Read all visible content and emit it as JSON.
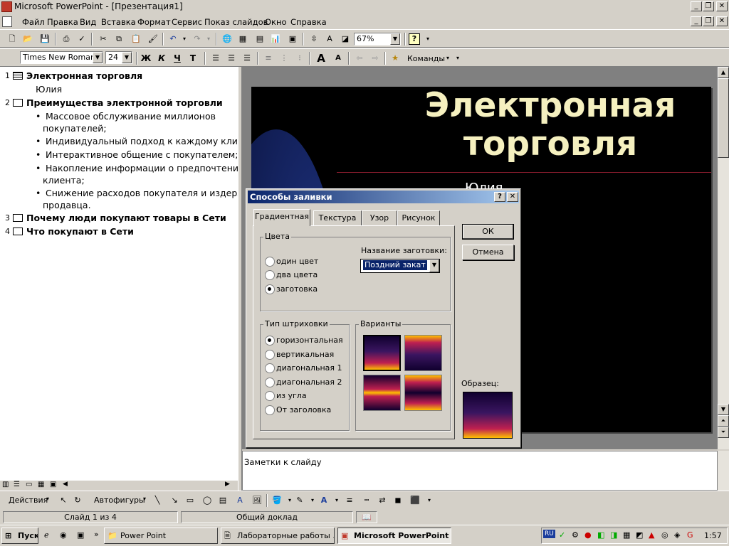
{
  "app": {
    "title": "Microsoft PowerPoint - [Презентация1]"
  },
  "menu": [
    "Файл",
    "Правка",
    "Вид",
    "Вставка",
    "Формат",
    "Сервис",
    "Показ слайдов",
    "Окно",
    "Справка"
  ],
  "toolbar": {
    "zoom": "67%",
    "help": "?",
    "font_name": "Times New Roman",
    "font_size": "24",
    "commands": "Команды"
  },
  "outline": {
    "slides": [
      {
        "num": "1",
        "title": "Электронная торговля",
        "sub": [
          "Юлия"
        ]
      },
      {
        "num": "2",
        "title": "Преимущества электронной торговли",
        "bullets": [
          [
            "Массовое обслуживание миллионов",
            "покупателей;"
          ],
          [
            "Индивидуальный подход к каждому клиенту;"
          ],
          [
            "Интерактивное общение с покупателем;"
          ],
          [
            "Накопление информации о предпочтениях",
            "клиента;"
          ],
          [
            "Снижение расходов покупателя и издержек",
            "продавца."
          ]
        ]
      },
      {
        "num": "3",
        "title": "Почему люди покупают товары в Сети"
      },
      {
        "num": "4",
        "title": "Что покупают в Сети"
      }
    ]
  },
  "slide": {
    "title_line1": "Электронная",
    "title_line2": "торговля",
    "subtitle": "Юлия",
    "title_color": "#f5f0bf"
  },
  "notes": {
    "text": "Заметки к слайду"
  },
  "drawing": {
    "actions": "Действия",
    "autoshapes": "Автофигуры"
  },
  "status": {
    "slide": "Слайд 1 из 4",
    "design": "Общий доклад"
  },
  "taskbar": {
    "start": "Пуск",
    "buttons": [
      "Power Point",
      "Лабораторные работы ...",
      "Microsoft PowerPoint ..."
    ],
    "lang": "RU",
    "clock": "1:57"
  },
  "dialog": {
    "title": "Способы заливки",
    "help": "?",
    "close": "✕",
    "tabs": [
      "Градиентная",
      "Текстура",
      "Узор",
      "Рисунок"
    ],
    "colors_group": "Цвета",
    "color_options": [
      "один цвет",
      "два цвета",
      "заготовка"
    ],
    "preset_label": "Название заготовки:",
    "preset_value": "Поздний закат",
    "hatch_group": "Тип штриховки",
    "hatch_options": [
      "горизонтальная",
      "вертикальная",
      "диагональная 1",
      "диагональная 2",
      "из угла",
      "От заголовка"
    ],
    "variants_group": "Варианты",
    "sample_label": "Образец:",
    "ok": "ОК",
    "cancel": "Отмена"
  }
}
